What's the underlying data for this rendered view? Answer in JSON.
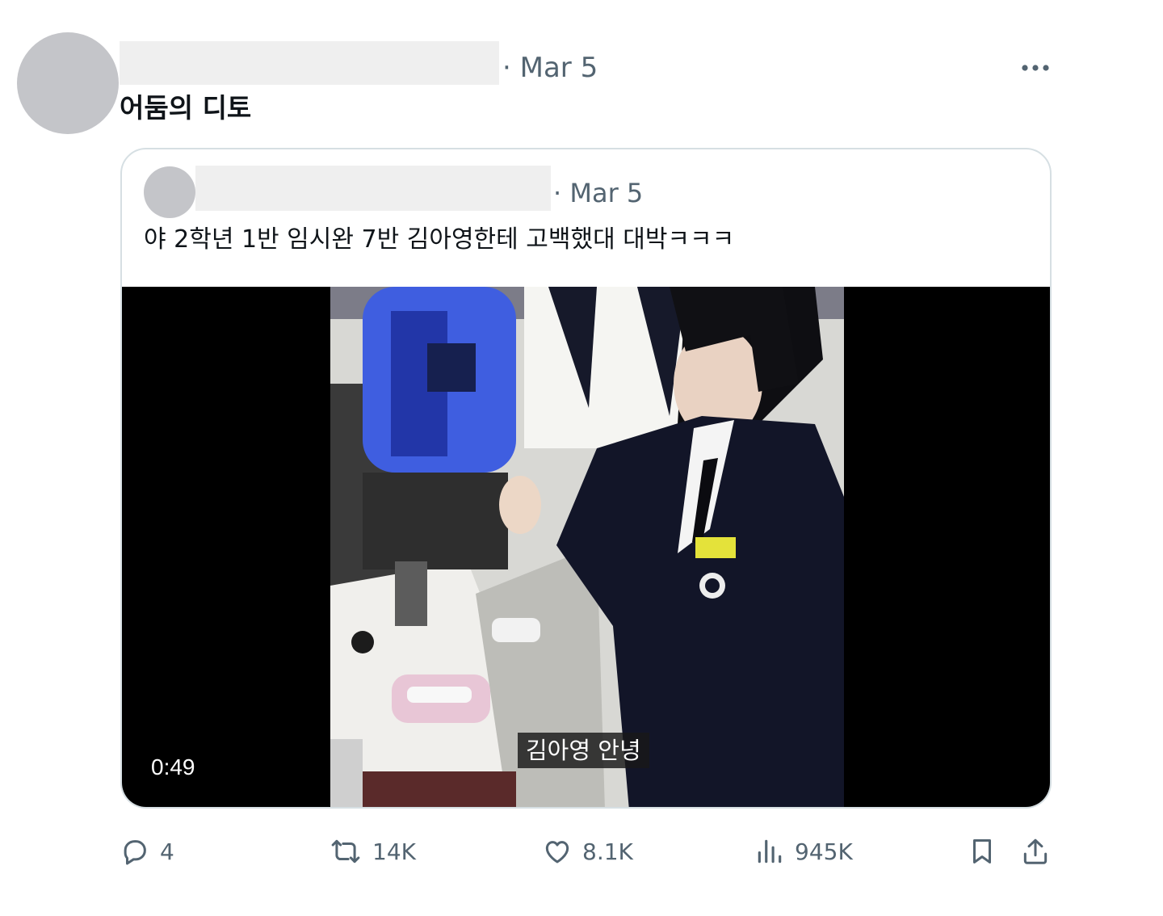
{
  "post": {
    "date": "· Mar 5",
    "text": "어둠의 디토",
    "more_icon": "more-horizontal-icon"
  },
  "quote": {
    "date": "· Mar 5",
    "text": "야 2학년 1반 임시완 7반 김아영한테 고백했대 대박ㅋㅋㅋ",
    "video": {
      "duration": "0:49",
      "subtitle": "김아영 안녕"
    }
  },
  "actions": {
    "replies": {
      "icon": "reply-icon",
      "count": "4"
    },
    "reposts": {
      "icon": "repost-icon",
      "count": "14K"
    },
    "likes": {
      "icon": "heart-icon",
      "count": "8.1K"
    },
    "views": {
      "icon": "views-icon",
      "count": "945K"
    },
    "bookmark": {
      "icon": "bookmark-icon"
    },
    "share": {
      "icon": "share-icon"
    }
  },
  "colors": {
    "secondary_text": "#536471",
    "primary_text": "#0f1419",
    "border": "#d6dfe3",
    "redaction": "#efefef",
    "avatar": "#c4c5c9"
  }
}
